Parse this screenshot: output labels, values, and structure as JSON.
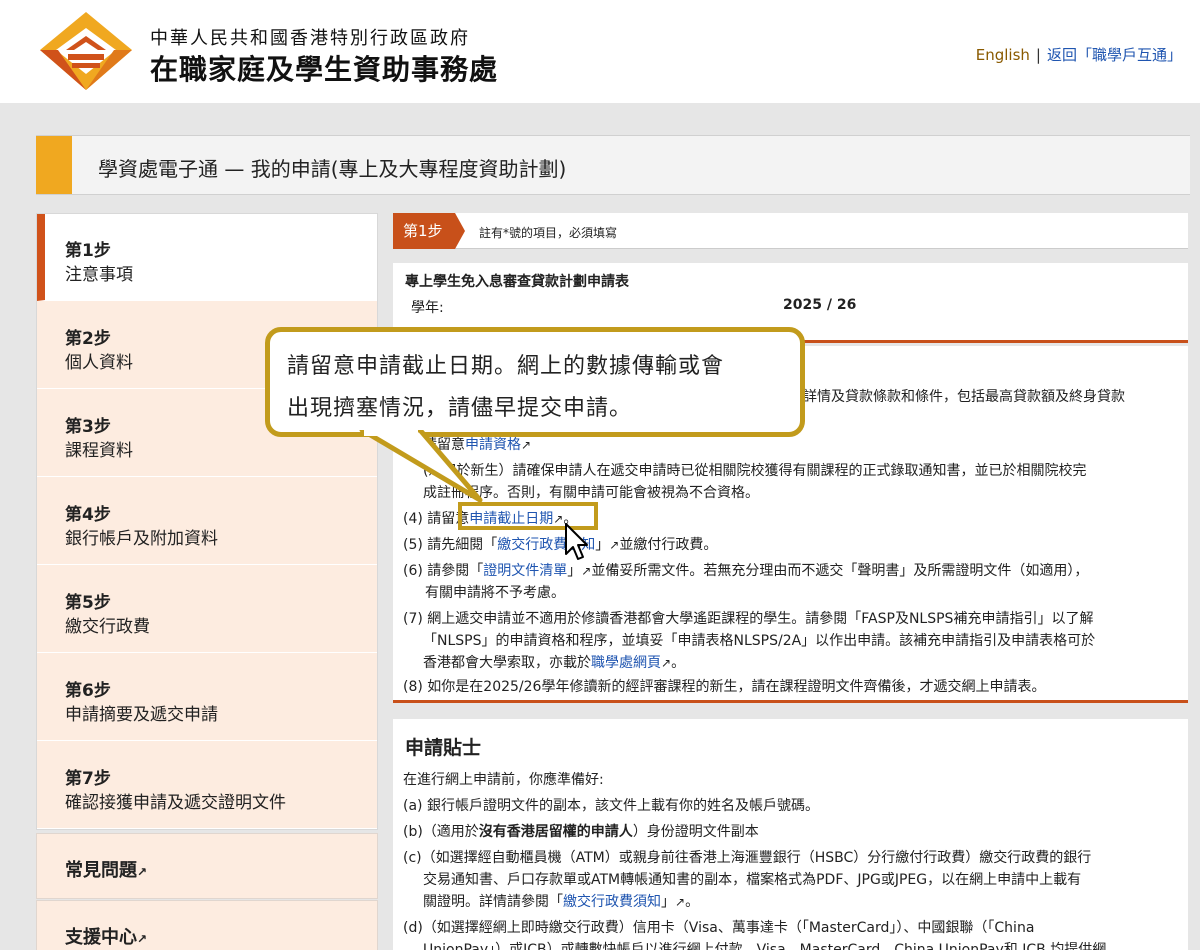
{
  "header": {
    "org_small": "中華人民共和國香港特別行政區政府",
    "org_big": "在職家庭及學生資助事務處",
    "lang_link": "English",
    "separator": "|",
    "back_link": "返回「職學戶互通」"
  },
  "page_title": "學資處電子通 — 我的申請(專上及大專程度資助計劃)",
  "sidebar": {
    "steps": [
      {
        "num": "第1步",
        "name": "注意事項"
      },
      {
        "num": "第2步",
        "name": "個人資料"
      },
      {
        "num": "第3步",
        "name": "課程資料"
      },
      {
        "num": "第4步",
        "name": "銀行帳戶及附加資料"
      },
      {
        "num": "第5步",
        "name": "繳交行政費"
      },
      {
        "num": "第6步",
        "name": "申請摘要及遞交申請"
      },
      {
        "num": "第7步",
        "name": "確認接獲申請及遞交證明文件"
      }
    ],
    "links": [
      {
        "label": "常見問題"
      },
      {
        "label": "支援中心"
      }
    ]
  },
  "step_head": {
    "tag": "第1步",
    "note": "註有*號的項目，必須填寫"
  },
  "form": {
    "title": "專上學生免入息審查貸款計劃申請表",
    "year_label": "學年:",
    "year_value": "2025 / 26"
  },
  "notes": {
    "l1": "詳情及貸款條款和條件，包括最高貸款額及終身貸款",
    "l2a": "請留意",
    "l2link": "申請資格",
    "l3": "(適用於新生）請確保申請人在遞交申請時已從相關院校獲得有關課程的正式錄取通知書，並已於相關院校完",
    "l4": "成註冊程序。否則，有關申請可能會被視為不合資格。",
    "l5a": "(4) 請留意",
    "l5link": "申請截止日期",
    "l5b": "。",
    "l6a": "(5) 請先細閱「",
    "l6link": "繳交行政費須知",
    "l6b": "」",
    "l6c": "並繳付行政費。",
    "l7a": "(6) 請參閱「",
    "l7link": "證明文件清單",
    "l7b": "」",
    "l7c": "並備妥所需文件。若無充分理由而不遞交「聲明書」及所需證明文件（如適用），",
    "l8": "有關申請將不予考慮。",
    "l9": "(7) 網上遞交申請並不適用於修讀香港都會大學遙距課程的學生。請參閱「FASP及NLSPS補充申請指引」以了解",
    "l10": "「NLSPS」的申請資格和程序，並填妥「申請表格NLSPS/2A」以作出申請。該補充申請指引及申請表格可於",
    "l11a": "香港都會大學索取，亦載於",
    "l11link": "職學處網頁",
    "l11b": "。",
    "l12": "(8) 如你是在2025/26學年修讀新的經評審課程的新生，請在課程證明文件齊備後，才遞交網上申請表。"
  },
  "tips": {
    "title": "申請貼士",
    "intro": "在進行網上申請前，你應準備好:",
    "a": "(a) 銀行帳戶證明文件的副本，該文件上載有你的姓名及帳戶號碼。",
    "b1": "(b)（適用於",
    "b_bold": "沒有香港居留權的申請人",
    "b2": "）身份證明文件副本",
    "c1": "(c)（如選擇經自動櫃員機（ATM）或親身前往香港上海滙豐銀行（HSBC）分行繳付行政費）繳交行政費的銀行",
    "c2": "交易通知書、戶口存款單或ATM轉帳通知書的副本，檔案格式為PDF、JPG或JPEG，以在網上申請中上載有",
    "c3a": "關證明。詳情請參閱「",
    "c3link": "繳交行政費須知",
    "c3b": "」",
    "c3c": "。",
    "d1": "(d)（如選擇經網上即時繳交行政費）信用卡（Visa、萬事達卡（「MasterCard」）、中國銀聯（「China",
    "d2": "UnionPay」）或JCB）或轉數快帳戶以進行網上付款。Visa、MasterCard、China UnionPay和 JCB 均提供網"
  },
  "callout": {
    "line1": "請留意申請截止日期。網上的數據傳輸或會",
    "line2": "出現擠塞情況，請儘早提交申請。"
  },
  "icons": {
    "external": "↗"
  },
  "colors": {
    "accent_orange": "#c8501a",
    "accent_gold": "#c29b1c",
    "title_accent": "#f0a820",
    "link_blue": "#1f55b0"
  }
}
